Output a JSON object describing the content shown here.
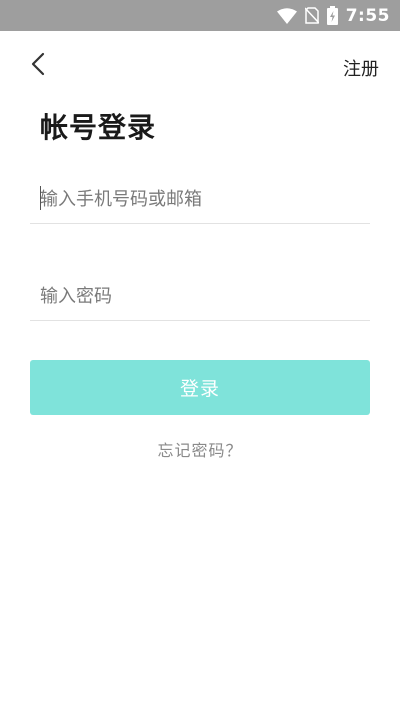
{
  "status_bar": {
    "time": "7:55",
    "icons": [
      "wifi-icon",
      "no-sim-icon",
      "battery-charging-icon"
    ]
  },
  "header": {
    "back_icon": "chevron-left-icon",
    "register_label": "注册"
  },
  "page": {
    "title": "帐号登录"
  },
  "form": {
    "phone_placeholder": "输入手机号码或邮箱",
    "password_placeholder": "输入密码",
    "login_label": "登录",
    "forgot_label": "忘记密码？"
  },
  "colors": {
    "status_bar_bg": "#9e9e9e",
    "accent": "#7fe3da",
    "divider": "#e2e2e2"
  }
}
